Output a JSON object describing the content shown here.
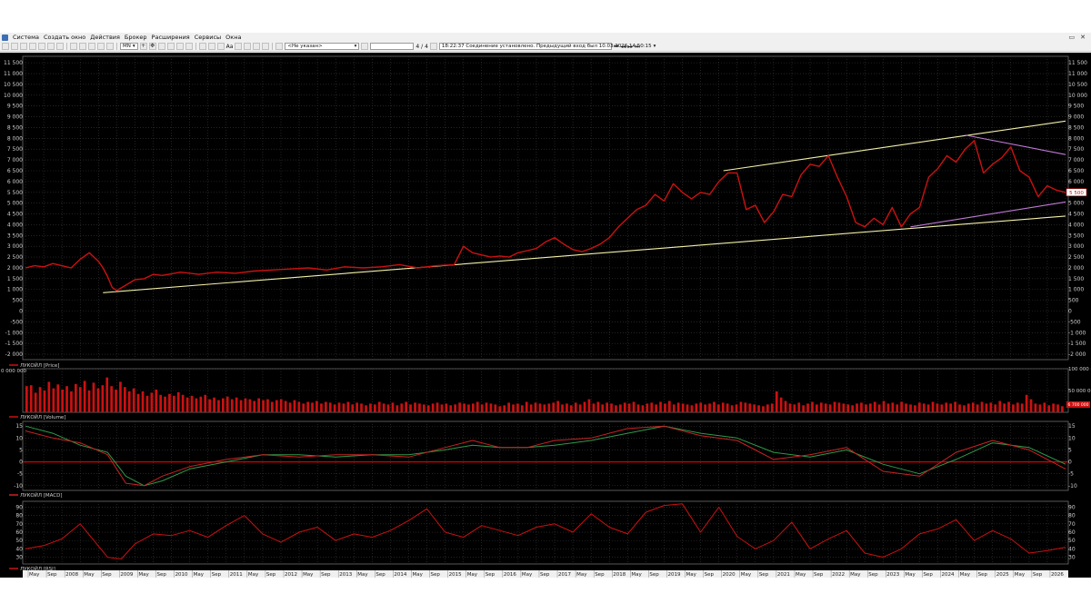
{
  "menu": [
    "Система",
    "Создать окно",
    "Действия",
    "Брокер",
    "Расширения",
    "Сервисы",
    "Окна"
  ],
  "toolbar": {
    "timeframe": "MN",
    "font_btn": "Aa",
    "account_placeholder": "<Не указан>",
    "pages": "4 / 4",
    "status": "18:22:37  Соединение установлено. Предыдущий вход был 10.03.2026 14:50:15"
  },
  "window_controls": {
    "restore": "▭",
    "close": "✕"
  },
  "colors": {
    "price": "#cc1111",
    "volume": "#cc1111",
    "macd": "#cc2222",
    "signal": "#2f9a4a",
    "rsi": "#cc1111",
    "trend_yellow": "#f3f0a8",
    "trend_violet": "#c07ad6",
    "grid": "#3a3a3a",
    "axis_text": "#cfcfcf",
    "panel_border": "#6d6d6d",
    "zero_line": "#cc0000"
  },
  "chart_data": [
    {
      "type": "line",
      "label": "ЛУКОЙЛ [Price]",
      "last_value": "5 500",
      "y_ticks": [
        "11 500",
        "11 000",
        "10 500",
        "10 000",
        "9 500",
        "9 000",
        "8 500",
        "8 000",
        "7 500",
        "7 000",
        "6 500",
        "6 000",
        "5 500",
        "5 000",
        "4 500",
        "4 000",
        "3 500",
        "3 000",
        "2 500",
        "2 000",
        "1 500",
        "1 000",
        "500",
        "0",
        "-500",
        "-1 000",
        "-1 500",
        "-2 000"
      ],
      "ylim": [
        -2250,
        11800
      ],
      "x": [
        0,
        2,
        4,
        6,
        8,
        10,
        12,
        14,
        15,
        16,
        17,
        18,
        19,
        20,
        22,
        24,
        26,
        28,
        30,
        34,
        38,
        42,
        46,
        50,
        54,
        58,
        62,
        66,
        70,
        74,
        78,
        82,
        86,
        90,
        94,
        96,
        98,
        100,
        102,
        104,
        106,
        108,
        110,
        112,
        114,
        116,
        118,
        120,
        122,
        124,
        126,
        128,
        130,
        132,
        134,
        136,
        138,
        140,
        142,
        144,
        146,
        148,
        150,
        152,
        154,
        156,
        158,
        160,
        162,
        164,
        166,
        168,
        170,
        172,
        174,
        176,
        178,
        180,
        182,
        184,
        186,
        188,
        190,
        192,
        194,
        196,
        198,
        200,
        202,
        204,
        206,
        208,
        210,
        212,
        214,
        216,
        218,
        220,
        222,
        224,
        226,
        228
      ],
      "values": [
        2000,
        2100,
        2050,
        2200,
        2100,
        2000,
        2400,
        2700,
        2500,
        2300,
        2000,
        1600,
        1100,
        950,
        1200,
        1450,
        1500,
        1700,
        1650,
        1800,
        1700,
        1800,
        1750,
        1850,
        1900,
        1950,
        2000,
        1900,
        2050,
        2000,
        2050,
        2150,
        2000,
        2100,
        2150,
        3000,
        2700,
        2600,
        2500,
        2550,
        2500,
        2700,
        2800,
        2900,
        3200,
        3400,
        3100,
        2850,
        2750,
        2900,
        3100,
        3400,
        3900,
        4300,
        4700,
        4900,
        5400,
        5100,
        5900,
        5500,
        5200,
        5500,
        5400,
        6000,
        6400,
        6400,
        4700,
        4900,
        4100,
        4600,
        5400,
        5300,
        6300,
        6800,
        6700,
        7200,
        6200,
        5300,
        4100,
        3900,
        4300,
        4000,
        4800,
        3900,
        4500,
        4800,
        6200,
        6600,
        7200,
        6900,
        7500,
        7900,
        6400,
        6800,
        7100,
        7600,
        6500,
        6200,
        5300,
        5800,
        5600,
        5500
      ]
    },
    {
      "type": "bar",
      "label": "ЛУКОЙЛ [Volume]",
      "y_ticks": [
        "100 000 000",
        "50 000 000"
      ],
      "left_tick": "0 000 000",
      "last_value": "6 700 000",
      "ylim": [
        0,
        100000000
      ],
      "values": [
        60,
        62,
        45,
        58,
        50,
        70,
        55,
        64,
        52,
        60,
        48,
        65,
        58,
        72,
        50,
        68,
        55,
        62,
        80,
        60,
        52,
        70,
        58,
        48,
        55,
        42,
        48,
        38,
        45,
        52,
        40,
        36,
        42,
        38,
        46,
        40,
        34,
        38,
        32,
        36,
        40,
        30,
        34,
        28,
        32,
        36,
        30,
        34,
        28,
        32,
        30,
        26,
        32,
        28,
        30,
        24,
        28,
        30,
        26,
        22,
        28,
        24,
        20,
        24,
        22,
        26,
        20,
        24,
        22,
        18,
        22,
        20,
        24,
        18,
        22,
        20,
        16,
        20,
        18,
        24,
        20,
        18,
        22,
        16,
        20,
        24,
        18,
        22,
        20,
        18,
        16,
        20,
        22,
        18,
        20,
        16,
        18,
        22,
        20,
        18,
        20,
        24,
        18,
        22,
        20,
        18,
        14,
        16,
        22,
        18,
        20,
        16,
        24,
        18,
        22,
        20,
        18,
        20,
        22,
        26,
        18,
        20,
        16,
        22,
        18,
        24,
        30,
        20,
        24,
        18,
        22,
        20,
        16,
        18,
        22,
        20,
        24,
        18,
        16,
        20,
        22,
        18,
        24,
        20,
        26,
        18,
        22,
        20,
        18,
        16,
        20,
        22,
        18,
        20,
        24,
        18,
        22,
        20,
        16,
        18,
        24,
        22,
        20,
        18,
        16,
        14,
        18,
        20,
        48,
        34,
        26,
        20,
        18,
        22,
        16,
        20,
        24,
        18,
        22,
        20,
        18,
        24,
        22,
        20,
        18,
        16,
        20,
        22,
        18,
        20,
        24,
        18,
        26,
        20,
        22,
        18,
        24,
        20,
        18,
        16,
        22,
        20,
        18,
        24,
        20,
        18,
        22,
        20,
        24,
        18,
        16,
        20,
        22,
        18,
        24,
        20,
        22,
        18,
        26,
        20,
        24,
        18,
        22,
        20,
        40,
        30,
        20,
        18,
        22,
        16,
        20,
        18,
        14
      ]
    },
    {
      "type": "line",
      "label": "ЛУКОЙЛ [MACD]",
      "y_ticks": [
        "15",
        "10",
        "5",
        "0",
        "-5",
        "-10"
      ],
      "ylim": [
        -12,
        17
      ],
      "x": [
        0,
        6,
        12,
        18,
        22,
        26,
        30,
        36,
        44,
        52,
        60,
        68,
        76,
        84,
        92,
        98,
        104,
        110,
        116,
        124,
        132,
        140,
        148,
        156,
        164,
        172,
        180,
        188,
        196,
        204,
        212,
        220,
        228
      ],
      "series": [
        {
          "name": "MACD",
          "values": [
            13,
            10,
            8,
            3,
            -9,
            -10,
            -6,
            -2,
            1,
            3,
            2,
            3,
            3,
            2,
            6,
            9,
            6,
            6,
            9,
            10,
            14,
            15,
            11,
            9,
            1,
            3,
            6,
            -4,
            -6,
            4,
            9,
            5,
            -3
          ]
        },
        {
          "name": "Signal",
          "values": [
            15,
            12,
            7,
            4,
            -6,
            -10,
            -8,
            -3,
            0,
            3,
            3,
            2,
            3,
            3,
            5,
            7,
            6,
            6,
            7,
            9,
            12,
            15,
            12,
            10,
            4,
            2,
            5,
            -1,
            -5,
            1,
            8,
            6,
            -1
          ]
        }
      ],
      "zero": 0
    },
    {
      "type": "line",
      "label": "ЛУКОЙЛ [RSI]",
      "y_ticks": [
        "90",
        "80",
        "70",
        "60",
        "50",
        "40",
        "30"
      ],
      "ylim": [
        22,
        97
      ],
      "x": [
        0,
        4,
        8,
        12,
        15,
        18,
        21,
        24,
        28,
        32,
        36,
        40,
        44,
        48,
        52,
        56,
        60,
        64,
        68,
        72,
        76,
        80,
        84,
        88,
        92,
        96,
        100,
        104,
        108,
        112,
        116,
        120,
        124,
        128,
        132,
        136,
        140,
        144,
        148,
        152,
        156,
        160,
        164,
        168,
        172,
        176,
        180,
        184,
        188,
        192,
        196,
        200,
        204,
        208,
        212,
        216,
        220,
        224,
        228
      ],
      "series": [
        {
          "name": "RSI",
          "values": [
            40,
            44,
            52,
            70,
            50,
            30,
            28,
            46,
            58,
            56,
            62,
            54,
            68,
            80,
            58,
            48,
            60,
            66,
            50,
            58,
            54,
            62,
            74,
            88,
            60,
            54,
            68,
            62,
            56,
            66,
            70,
            60,
            82,
            66,
            58,
            84,
            92,
            94,
            60,
            90,
            55,
            40,
            50,
            72,
            40,
            52,
            62,
            35,
            30,
            40,
            58,
            64,
            75,
            50,
            62,
            52,
            35,
            38,
            42
          ]
        }
      ]
    }
  ],
  "x_axis": {
    "labels": [
      "May",
      "Sep",
      "2008",
      "May",
      "Sep",
      "2009",
      "May",
      "Sep",
      "2010",
      "May",
      "Sep",
      "2011",
      "May",
      "Sep",
      "2012",
      "May",
      "Sep",
      "2013",
      "May",
      "Sep",
      "2014",
      "May",
      "Sep",
      "2015",
      "May",
      "Sep",
      "2016",
      "May",
      "Sep",
      "2017",
      "May",
      "Sep",
      "2018",
      "May",
      "Sep",
      "2019",
      "May",
      "Sep",
      "2020",
      "May",
      "Sep",
      "2021",
      "May",
      "Sep",
      "2022",
      "May",
      "Sep",
      "2023",
      "May",
      "Sep",
      "2024",
      "May",
      "Sep",
      "2025",
      "May",
      "Sep",
      "2026"
    ]
  }
}
